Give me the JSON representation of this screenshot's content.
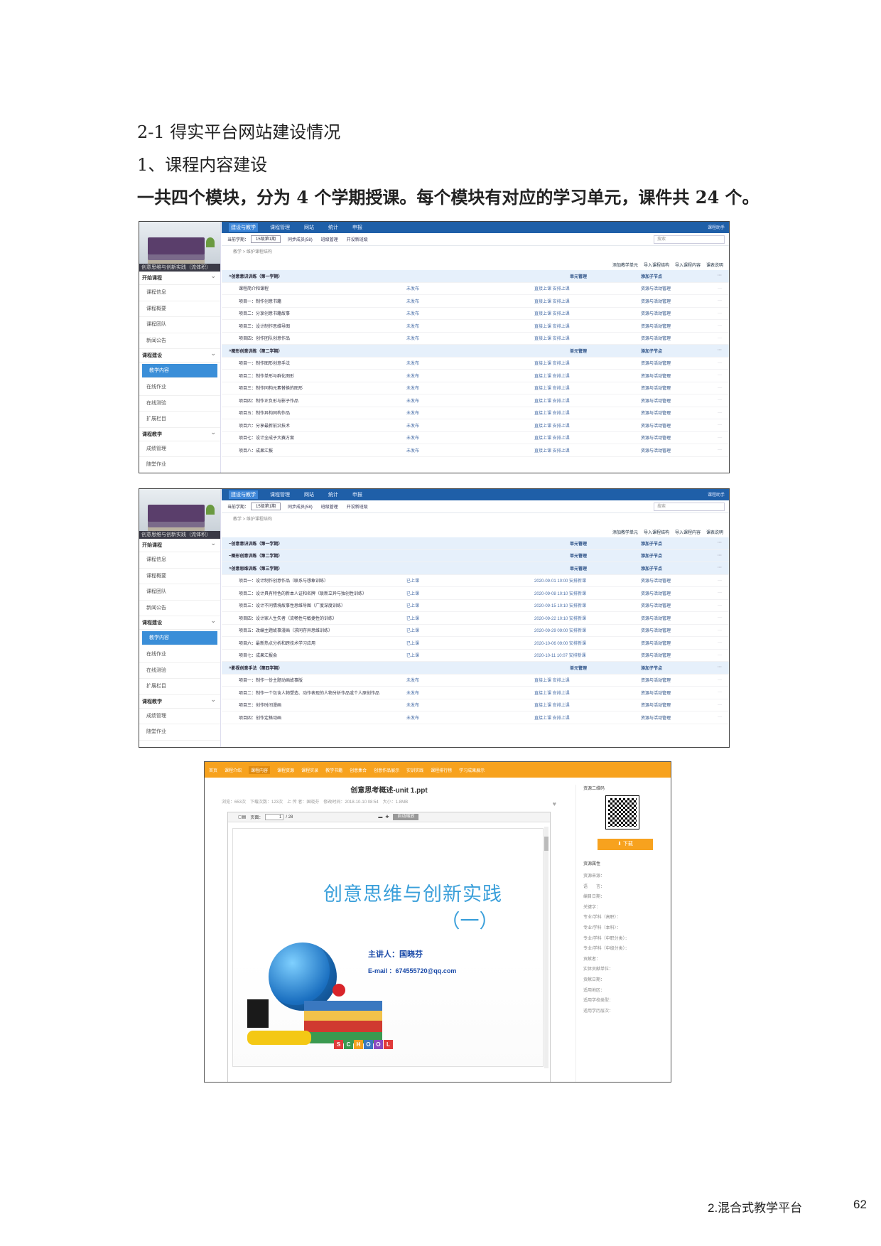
{
  "headings": {
    "section": "2-1 得实平台网站建设情况",
    "subsection": "1、课程内容建设",
    "summary": "一共四个模块，分为 4 个学期授课。每个模块有对应的学习单元，课件共 24 个。"
  },
  "shot1": {
    "sidebar": {
      "banner_caption": "创意思维与创新实践（流体积）",
      "groups": [
        {
          "label": "开始课程",
          "items": [
            "课程信息",
            "课程概要",
            "课程团队",
            "新闻公告"
          ]
        },
        {
          "label": "课程建设",
          "items": [
            "教学内容",
            "在线作业",
            "在线测验",
            "扩展栏目"
          ]
        },
        {
          "label": "课程教学",
          "items": [
            "成绩管理",
            "随堂作业"
          ]
        }
      ],
      "active": "教学内容"
    },
    "tabs": [
      "建设与教学",
      "课程管理",
      "网站",
      "统计",
      "申报"
    ],
    "tab_right": "课程助手",
    "toolbar": {
      "term_label": "当前学期：",
      "term_value": "15级第1期",
      "buttons": [
        "同步成员(58)",
        "班级管理",
        "开设新班级"
      ],
      "search_placeholder": "搜索"
    },
    "breadcrumb": "教学 > 维护课程结构",
    "actions": [
      "添加教学单元",
      "导入课程结构",
      "导入课程内容",
      "课表说明"
    ],
    "rows": [
      {
        "type": "module",
        "title": "^创意意识训练（第一学期）",
        "ops": "单元管理",
        "op2": "添加子节点"
      },
      {
        "type": "item",
        "title": "课程简介和课程",
        "status": "未发布",
        "links": "直接上课 安排上课",
        "ops": "资源与活动管理"
      },
      {
        "type": "item",
        "title": "项目一：制作创意书籍",
        "status": "未发布",
        "links": "直接上课 安排上课",
        "ops": "资源与活动管理"
      },
      {
        "type": "item",
        "title": "项目二：分享创意书籍故事",
        "status": "未发布",
        "links": "直接上课 安排上课",
        "ops": "资源与活动管理"
      },
      {
        "type": "item",
        "title": "项目三：设计制作思维导图",
        "status": "未发布",
        "links": "直接上课 安排上课",
        "ops": "资源与活动管理"
      },
      {
        "type": "item",
        "title": "项目四：创作团队创意作品",
        "status": "未发布",
        "links": "直接上课 安排上课",
        "ops": "资源与活动管理"
      },
      {
        "type": "module",
        "title": "^图形创意训练（第二学期）",
        "ops": "单元管理",
        "op2": "添加子节点"
      },
      {
        "type": "item",
        "title": "项目一：制作图形创意手法",
        "status": "未发布",
        "links": "直接上课 安排上课",
        "ops": "资源与活动管理"
      },
      {
        "type": "item",
        "title": "项目二：制作单形与群化图形",
        "status": "未发布",
        "links": "直接上课 安排上课",
        "ops": "资源与活动管理"
      },
      {
        "type": "item",
        "title": "项目三：制作同构元素替换的图形",
        "status": "未发布",
        "links": "直接上课 安排上课",
        "ops": "资源与活动管理"
      },
      {
        "type": "item",
        "title": "项目四：制作正负形与影子作品",
        "status": "未发布",
        "links": "直接上课 安排上课",
        "ops": "资源与活动管理"
      },
      {
        "type": "item",
        "title": "项目五：制作异构同构作品",
        "status": "未发布",
        "links": "直接上课 安排上课",
        "ops": "资源与活动管理"
      },
      {
        "type": "item",
        "title": "项目六：分享最新前沿技术",
        "status": "未发布",
        "links": "直接上课 安排上课",
        "ops": "资源与活动管理"
      },
      {
        "type": "item",
        "title": "项目七：设计全成子大赛方案",
        "status": "未发布",
        "links": "直接上课 安排上课",
        "ops": "资源与活动管理"
      },
      {
        "type": "item",
        "title": "项目八：成果汇报",
        "status": "未发布",
        "links": "直接上课 安排上课",
        "ops": "资源与活动管理"
      }
    ]
  },
  "shot2": {
    "sidebar": {
      "banner_caption": "创意思维与创新实践（流体积）",
      "groups": [
        {
          "label": "开始课程",
          "items": [
            "课程信息",
            "课程概要",
            "课程团队",
            "新闻公告"
          ]
        },
        {
          "label": "课程建设",
          "items": [
            "教学内容",
            "在线作业",
            "在线测验",
            "扩展栏目"
          ]
        },
        {
          "label": "课程教学",
          "items": [
            "成绩管理",
            "随堂作业"
          ]
        }
      ],
      "active": "教学内容"
    },
    "tabs": [
      "建设与教学",
      "课程管理",
      "网站",
      "统计",
      "申报"
    ],
    "tab_right": "课程助手",
    "toolbar": {
      "term_label": "当前学期：",
      "term_value": "15级第1期",
      "buttons": [
        "同步成员(58)",
        "班级管理",
        "开设新班级"
      ],
      "search_placeholder": "搜索"
    },
    "breadcrumb": "教学 > 维护课程结构",
    "actions": [
      "添加教学单元",
      "导入课程结构",
      "导入课程内容",
      "课表说明"
    ],
    "rows": [
      {
        "type": "module",
        "title": "~创意意识训练（第一学期）",
        "ops": "单元管理",
        "op2": "添加子节点"
      },
      {
        "type": "module",
        "title": "~图形创意训练（第二学期）",
        "ops": "单元管理",
        "op2": "添加子节点"
      },
      {
        "type": "module",
        "title": "^创意思维训练（第三学期）",
        "ops": "单元管理",
        "op2": "添加子节点"
      },
      {
        "type": "item",
        "title": "项目一：设计制作创意作品（联系与想象训练）",
        "status": "已上课",
        "links": "2020-09-01 10:00 安排新课",
        "ops": "资源与活动管理"
      },
      {
        "type": "item",
        "title": "项目二：设计具有特色的新本人证和名牌（联新立异与独创性训练）",
        "status": "已上课",
        "links": "2020-09-08 10:10 安排新课",
        "ops": "资源与活动管理"
      },
      {
        "type": "item",
        "title": "项目三：设计不同情境故事性思维导图（广度深度训练）",
        "status": "已上课",
        "links": "2020-09-15 10:10 安排新课",
        "ops": "资源与活动管理"
      },
      {
        "type": "item",
        "title": "项目四：设计家人生失者（流畅性与敏捷性的训练）",
        "status": "已上课",
        "links": "2020-09-22 10:10 安排新课",
        "ops": "资源与活动管理"
      },
      {
        "type": "item",
        "title": "项目五：改编主题故事漫画（求同存异思维训练）",
        "status": "已上课",
        "links": "2020-09-29 09:00 安排新课",
        "ops": "资源与活动管理"
      },
      {
        "type": "item",
        "title": "项目六：最新热点分析和跨技术学习应用",
        "status": "已上课",
        "links": "2020-10-06 09:00 安排新课",
        "ops": "资源与活动管理"
      },
      {
        "type": "item",
        "title": "项目七：成果汇报会",
        "status": "已上课",
        "links": "2020-10-11 10:07 安排新课",
        "ops": "资源与活动管理"
      },
      {
        "type": "module",
        "title": "^影视创意手法（第四学期）",
        "ops": "单元管理",
        "op2": "添加子节点"
      },
      {
        "type": "item",
        "title": "项目一：制作一份主题动画故事版",
        "status": "未发布",
        "links": "直接上课 安排上课",
        "ops": "资源与活动管理"
      },
      {
        "type": "item",
        "title": "项目二：制作一个包含人物塑造、动作表现的人物分析作品或个人原创作品",
        "status": "未发布",
        "links": "直接上课 安排上课",
        "ops": "资源与活动管理"
      },
      {
        "type": "item",
        "title": "项目三：创作时间漫画",
        "status": "未发布",
        "links": "直接上课 安排上课",
        "ops": "资源与活动管理"
      },
      {
        "type": "item",
        "title": "项目四：创作定格动画",
        "status": "未发布",
        "links": "直接上课 安排上课",
        "ops": "资源与活动管理"
      }
    ]
  },
  "shot3": {
    "nav": [
      "首页",
      "课程介绍",
      "课程内容",
      "课程资源",
      "课程实录",
      "教学书籍",
      "创意集合",
      "创意作品展示",
      "实训实践",
      "课程排行榜",
      "学习成果展示"
    ],
    "nav_active": "课程内容",
    "doc_title": "创意思考概述-unit 1.ppt",
    "doc_meta": "浏览：653次　下载次数：123次　上 传 者：国晓芬　修改时间：2018-10-10 08:54　大小：1.8MB",
    "viewer": {
      "page_label": "页面：",
      "page_value": "1",
      "page_total": "/ 28",
      "fit_label": "自动缩放"
    },
    "slide": {
      "title": "创意思维与创新实践",
      "subtitle": "（一）",
      "speaker": "主讲人：国晓芬",
      "email": "E-mail ：674555720@qq.com",
      "blocks": [
        "S",
        "C",
        "H",
        "O",
        "O",
        "L"
      ]
    },
    "side": {
      "qr_label": "资源二维码",
      "download": "下载",
      "props_label": "资源属性",
      "props": [
        "资源来源：",
        "语　　言：",
        "编目日期：",
        "关键字：",
        "专业/学科（高职）：",
        "专业/学科（本科）：",
        "专业/学科（中职分类）：",
        "专业/学科（中级分类）：",
        "贡献者：",
        "实体贡献单位：",
        "贡献日期：",
        "适用地区：",
        "适用学校类型：",
        "适用学历层次："
      ]
    }
  },
  "footer": {
    "chapter": "2.混合式教学平台",
    "page": "62"
  },
  "colors": {
    "tab_bar": "#1f5fa8",
    "active_item": "#3a8ed8",
    "orange_nav": "#f7a21e",
    "slide_title": "#3a9fda"
  }
}
